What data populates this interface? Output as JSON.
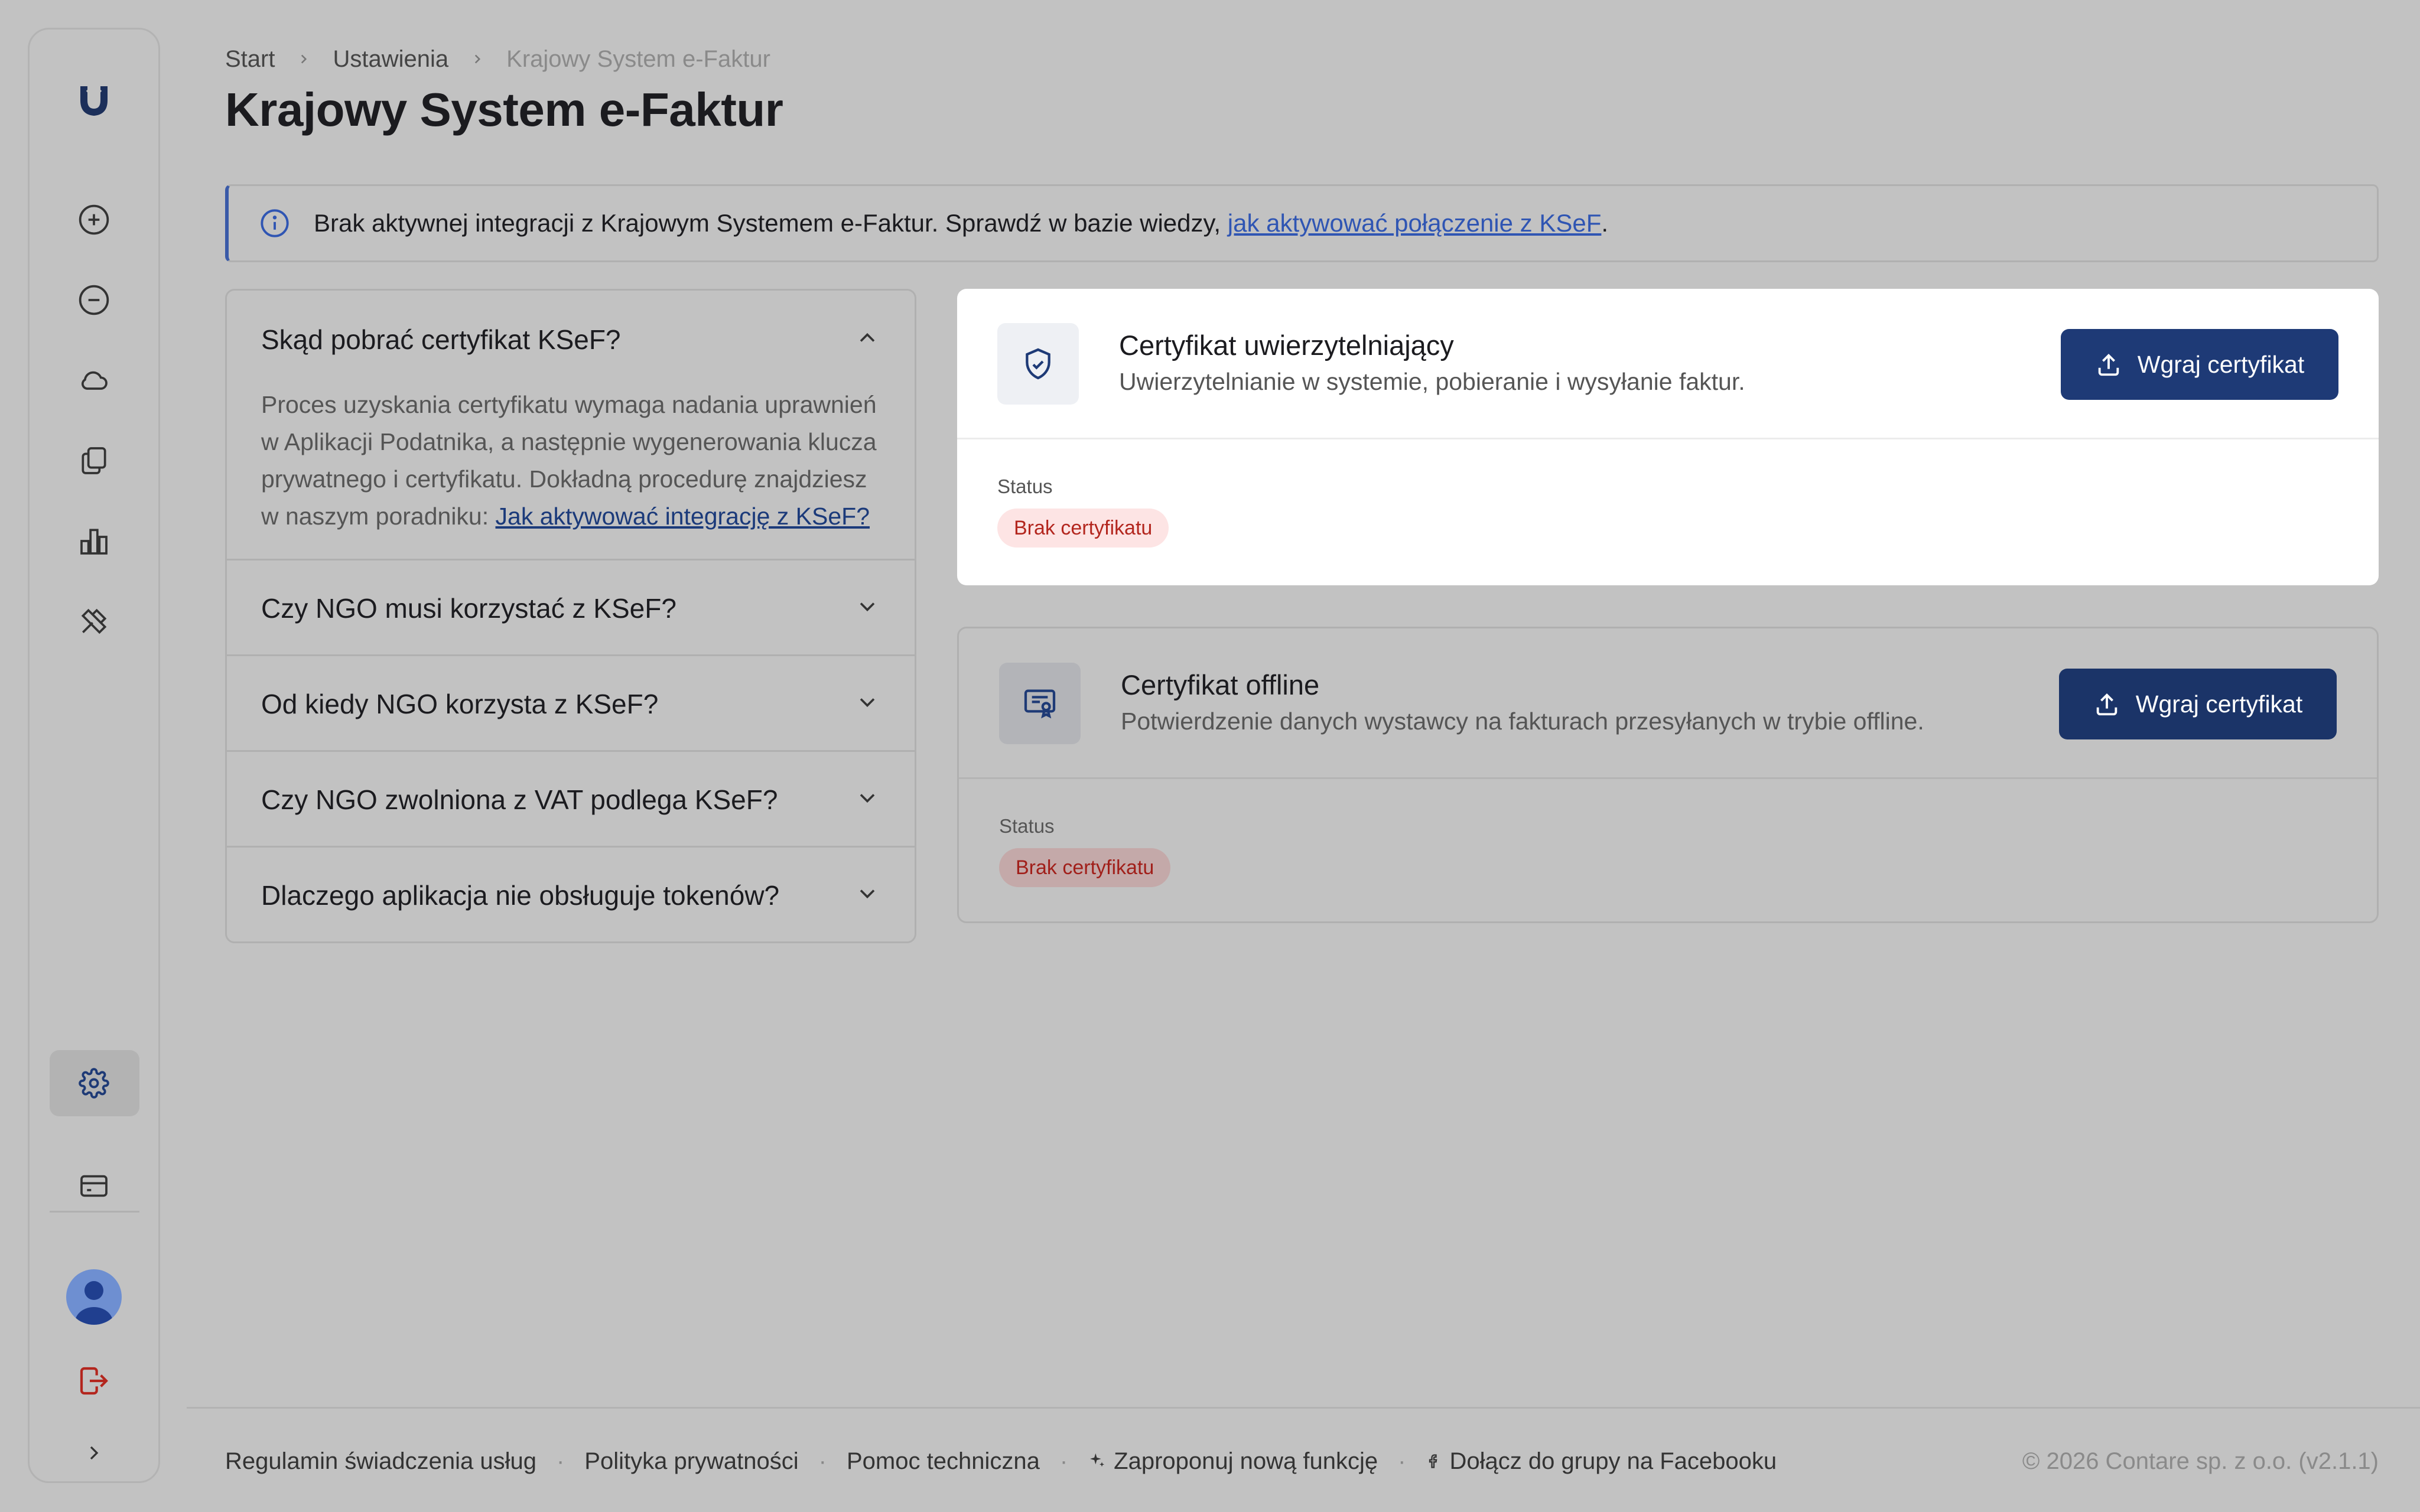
{
  "breadcrumb": {
    "items": [
      "Start",
      "Ustawienia",
      "Krajowy System e-Faktur"
    ]
  },
  "page": {
    "title": "Krajowy System e-Faktur"
  },
  "banner": {
    "text": "Brak aktywnej integracji z Krajowym Systemem e-Faktur. Sprawdź w bazie wiedzy, ",
    "link": "jak aktywować połączenie z KSeF",
    "suffix": "."
  },
  "faq": {
    "items": [
      {
        "question": "Skąd pobrać certyfikat KSeF?",
        "expanded": true,
        "answer": "Proces uzyskania certyfikatu wymaga nadania uprawnień w Aplikacji Podatnika, a następnie wygenerowania klucza prywatnego i certyfikatu. Dokładną procedurę znajdziesz w naszym poradniku: ",
        "answer_link": "Jak aktywować integrację z KSeF?"
      },
      {
        "question": "Czy NGO musi korzystać z KSeF?",
        "expanded": false
      },
      {
        "question": "Od kiedy NGO korzysta z KSeF?",
        "expanded": false
      },
      {
        "question": "Czy NGO zwolniona z VAT podlega KSeF?",
        "expanded": false
      },
      {
        "question": "Dlaczego aplikacja nie obsługuje tokenów?",
        "expanded": false
      }
    ]
  },
  "cards": [
    {
      "title": "Certyfikat uwierzytelniający",
      "description": "Uwierzytelnianie w systemie, pobieranie i wysyłanie faktur.",
      "button": "Wgraj certyfikat",
      "status_label": "Status",
      "status": "Brak certyfikatu",
      "icon": "shield-check-icon"
    },
    {
      "title": "Certyfikat offline",
      "description": "Potwierdzenie danych wystawcy na fakturach przesyłanych w trybie offline.",
      "button": "Wgraj certyfikat",
      "status_label": "Status",
      "status": "Brak certyfikatu",
      "icon": "certificate-icon"
    }
  ],
  "footer": {
    "links": [
      "Regulamin świadczenia usług",
      "Polityka prywatności",
      "Pomoc techniczna",
      "Zaproponuj nową funkcję",
      "Dołącz do grupy na Facebooku"
    ],
    "copyright": "© 2026 Contare sp. z o.o. (v2.1.1)"
  },
  "colors": {
    "primary": "#1e3a76",
    "link": "#2f55b3",
    "danger": "#b3261e",
    "background": "#c2c2c2"
  }
}
